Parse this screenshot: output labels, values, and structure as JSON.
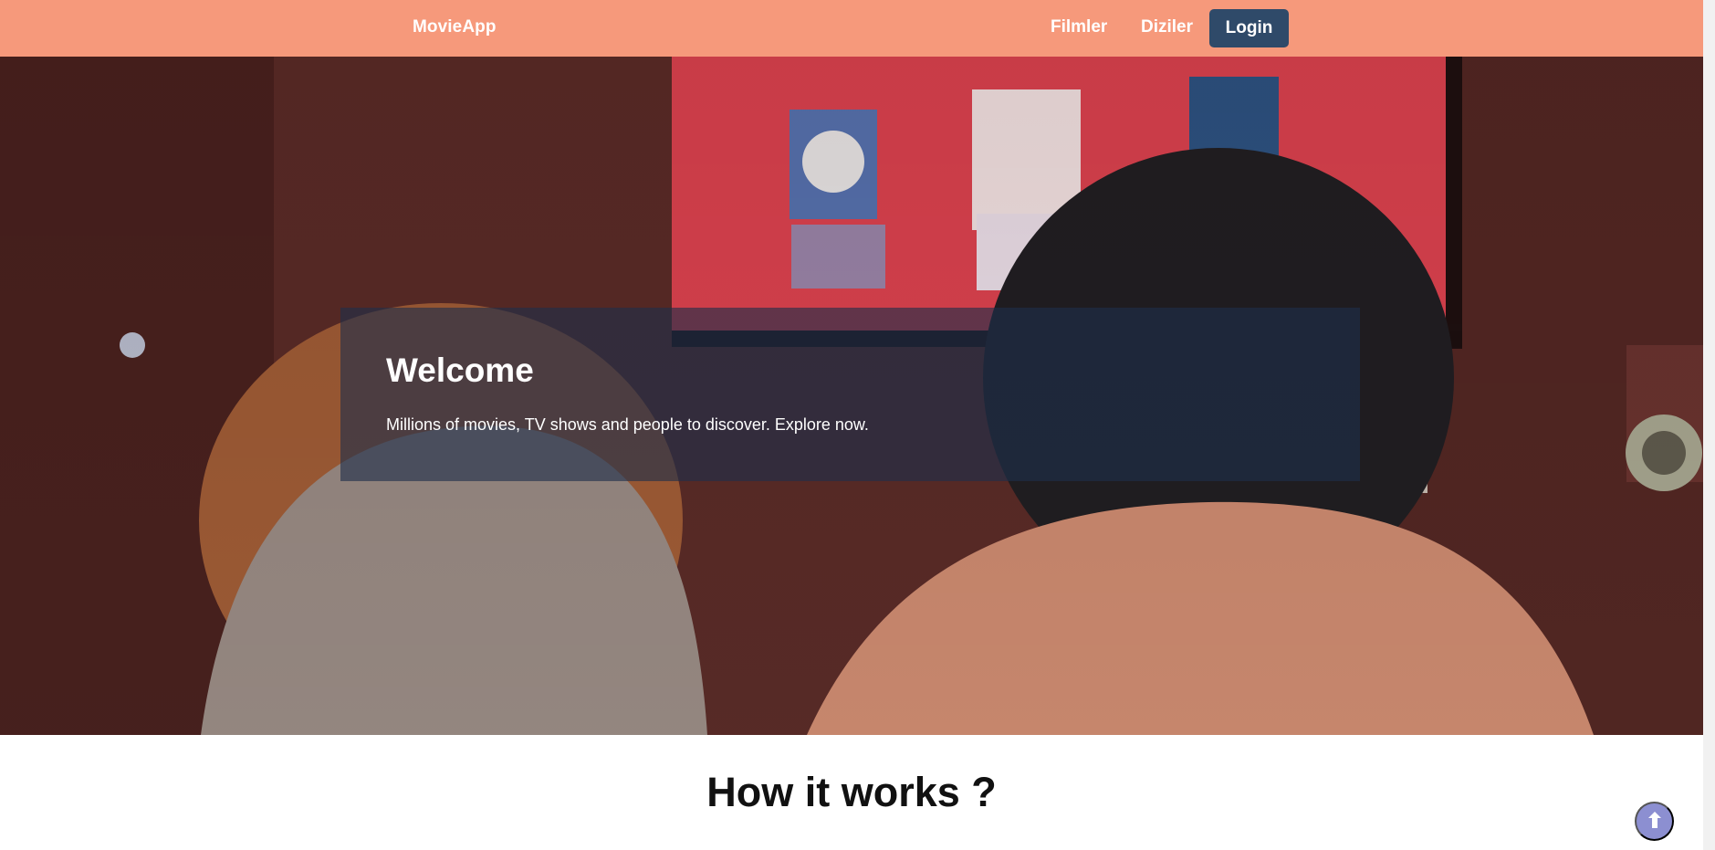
{
  "brand": {
    "name": "MovieApp"
  },
  "nav": {
    "items": [
      {
        "label": "Filmler"
      },
      {
        "label": "Diziler"
      }
    ],
    "login_label": "Login"
  },
  "hero": {
    "title": "Welcome",
    "subtitle": "Millions of movies, TV shows and people to discover. Explore now."
  },
  "section": {
    "title": "How it works ?"
  },
  "icons": {
    "scroll_top": "arrow-up-icon"
  },
  "colors": {
    "navbar": "#f6997b",
    "login_button": "#2f4a69",
    "overlay": "#1f2f4b",
    "scroll_top": "#8c8fd1"
  }
}
